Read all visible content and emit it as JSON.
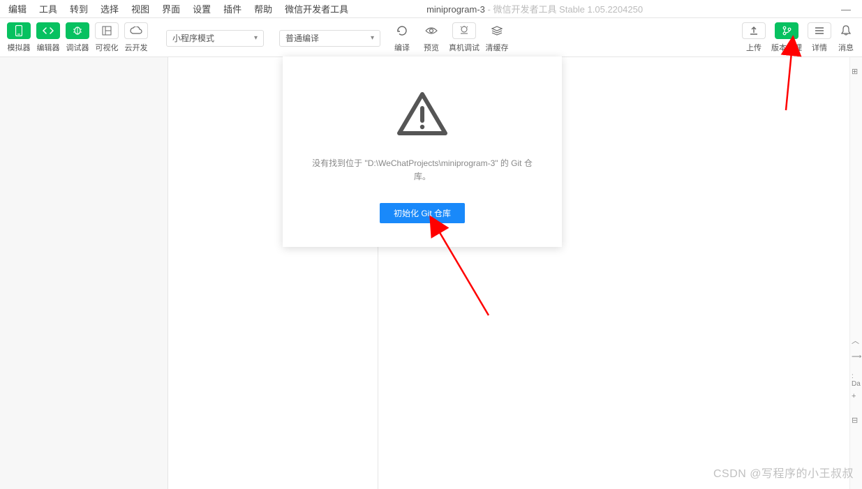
{
  "menu": {
    "items": [
      "编辑",
      "工具",
      "转到",
      "选择",
      "视图",
      "界面",
      "设置",
      "插件",
      "帮助"
    ],
    "devtool": "微信开发者工具"
  },
  "title": {
    "main": "miniprogram-3",
    "sub": " - 微信开发者工具 Stable 1.05.2204250"
  },
  "toolbar": {
    "simulator": "模拟器",
    "editor": "编辑器",
    "debugger": "调试器",
    "visualize": "可视化",
    "cloud": "云开发",
    "modeSelect": "小程序模式",
    "compileSelect": "普通编译",
    "compile": "编译",
    "preview": "预览",
    "realDevice": "真机调试",
    "clearCache": "清缓存",
    "upload": "上传",
    "version": "版本管理",
    "details": "详情",
    "message": "消息"
  },
  "modal": {
    "text1": "没有找到位于 \"D:\\WeChatProjects\\miniprogram-3\" 的 Git 仓",
    "text2": "库。",
    "button": "初始化 Git 仓库"
  },
  "watermark": "CSDN @写程序的小王叔叔",
  "sidebar_text": ": Da"
}
